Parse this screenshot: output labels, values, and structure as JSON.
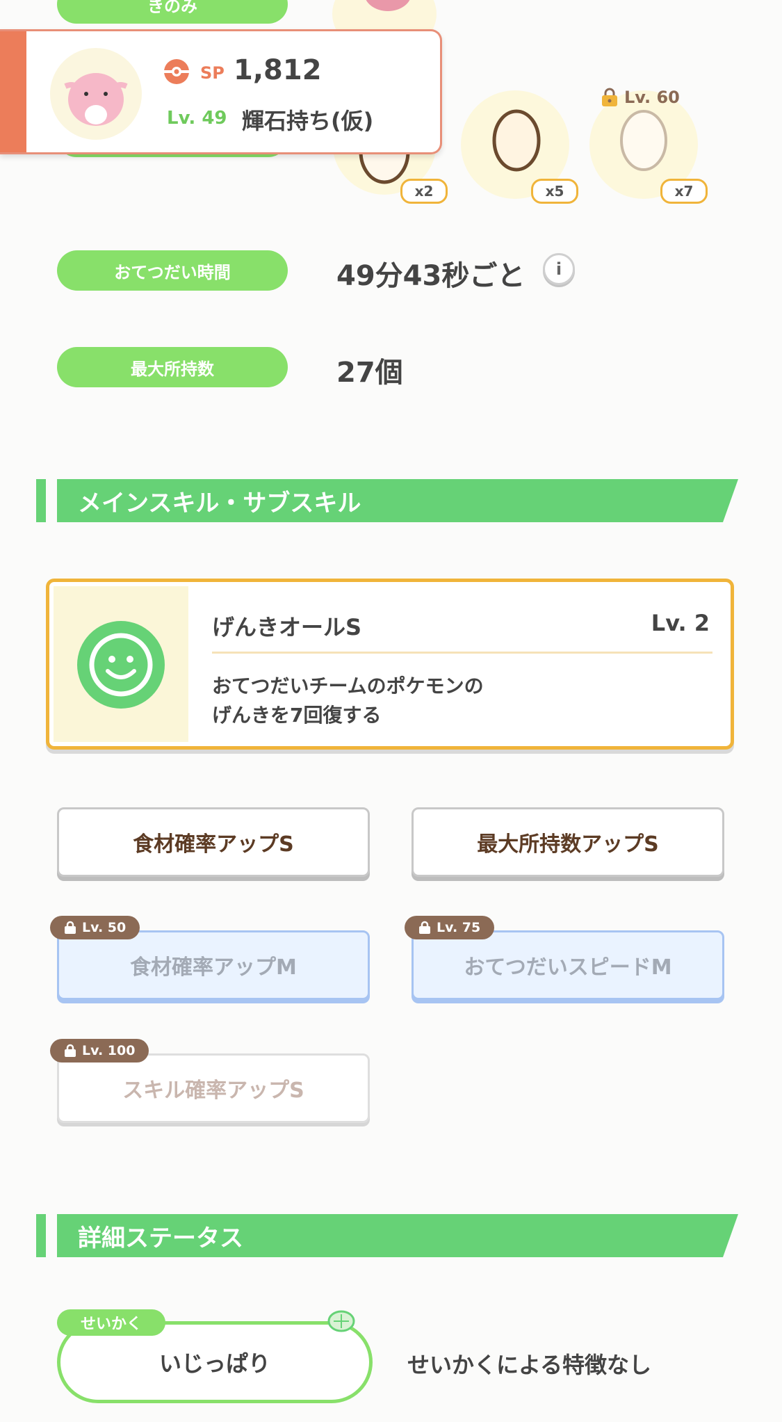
{
  "top": {
    "partial_label": "きのみ",
    "eggs": [
      {
        "count": "x2"
      },
      {
        "count": "x5"
      },
      {
        "count": "x7",
        "lock_level": "Lv. 60"
      }
    ]
  },
  "pokemon_card": {
    "sp_label": "SP",
    "sp_value": "1,812",
    "level": "Lv. 49",
    "item": "輝石持ち(仮)"
  },
  "stats": {
    "help_time": {
      "label": "おてつだい時間",
      "value": "49分43秒ごと"
    },
    "max_carry": {
      "label": "最大所持数",
      "value": "27個"
    }
  },
  "skills_section": {
    "title": "メインスキル・サブスキル",
    "main_skill": {
      "name": "げんきオールS",
      "level": "Lv. 2",
      "description_line1": "おてつだいチームのポケモンの",
      "description_line2": "げんきを7回復する"
    },
    "sub_skills": [
      {
        "name": "食材確率アップS"
      },
      {
        "name": "最大所持数アップS"
      },
      {
        "name": "食材確率アップM",
        "lock_level": "Lv. 50"
      },
      {
        "name": "おてつだいスピードM",
        "lock_level": "Lv. 75"
      },
      {
        "name": "スキル確率アップS",
        "lock_level": "Lv. 100"
      }
    ]
  },
  "detail_section": {
    "title": "詳細ステータス",
    "nature_tag": "せいかく",
    "nature_value": "いじっぱり",
    "nature_effect": "せいかくによる特徴なし"
  },
  "colors": {
    "green_accent": "#66d276",
    "pill_green": "#88e06a",
    "gold_border": "#f0b43a",
    "lock_brown": "#8b6a55",
    "card_accent": "#ec7d5a"
  }
}
